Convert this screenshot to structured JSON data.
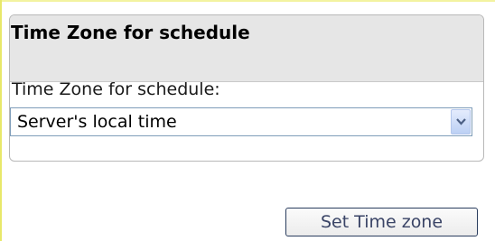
{
  "panel": {
    "title": "Time Zone for schedule",
    "field_label": "Time Zone for schedule:",
    "select": {
      "value": "Server's local time",
      "arrow_icon": "chevron-down-icon"
    }
  },
  "actions": {
    "set_button_label": "Set Time zone"
  },
  "colors": {
    "frame_accent": "#e8e86a",
    "header_bg": "#e6e6e6",
    "select_border": "#7f9db9",
    "button_border": "#2a3d5e"
  }
}
